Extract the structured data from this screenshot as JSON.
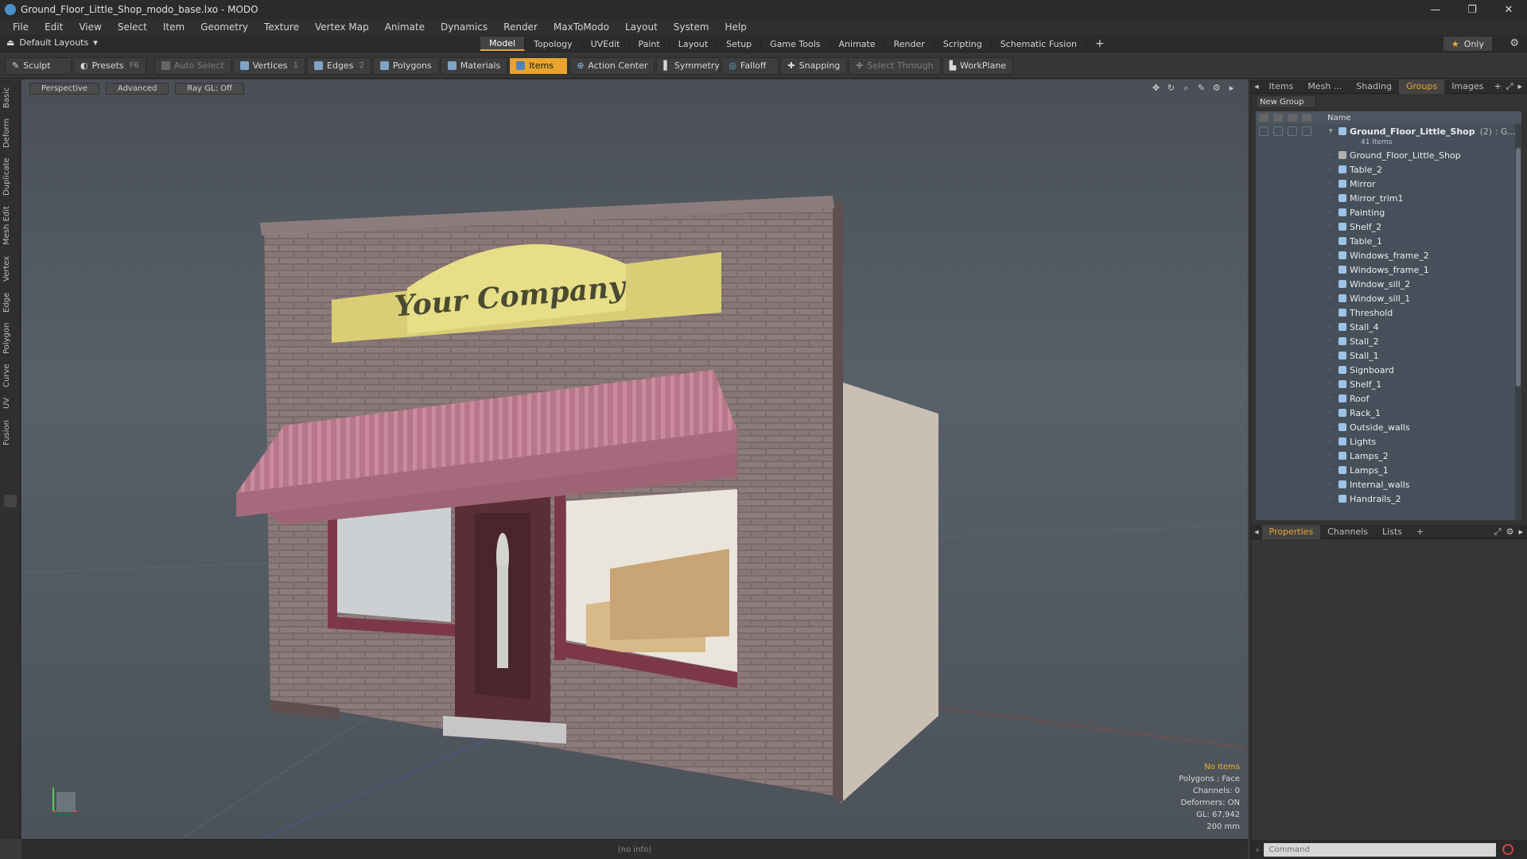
{
  "window": {
    "title": "Ground_Floor_Little_Shop_modo_base.lxo - MODO",
    "controls": [
      "—",
      "❐",
      "✕"
    ]
  },
  "menubar": [
    "File",
    "Edit",
    "View",
    "Select",
    "Item",
    "Geometry",
    "Texture",
    "Vertex Map",
    "Animate",
    "Dynamics",
    "Render",
    "MaxToModo",
    "Layout",
    "System",
    "Help"
  ],
  "layoutbar": {
    "layouts_label": "Default Layouts",
    "tabs": [
      "Model",
      "Topology",
      "UVEdit",
      "Paint",
      "Layout",
      "Setup",
      "Game Tools",
      "Animate",
      "Render",
      "Scripting",
      "Schematic Fusion"
    ],
    "active_tab": "Model",
    "add_label": "+",
    "only_label": "Only"
  },
  "toolbar": {
    "sculpt": "Sculpt",
    "presets": "Presets",
    "presets_key": "F6",
    "auto_select": "Auto Select",
    "vertices": "Vertices",
    "vertices_count": "1",
    "edges": "Edges",
    "edges_count": "2",
    "polygons": "Polygons",
    "materials": "Materials",
    "items": "Items",
    "action_center": "Action Center",
    "symmetry": "Symmetry",
    "falloff": "Falloff",
    "snapping": "Snapping",
    "select_through": "Select Through",
    "workplane": "WorkPlane"
  },
  "left_tabs": [
    "Basic",
    "Deform",
    "Duplicate",
    "Mesh Edit",
    "Vertex",
    "Edge",
    "Polygon",
    "Curve",
    "UV",
    "Fusion"
  ],
  "viewport": {
    "header": [
      "Perspective",
      "Advanced",
      "Ray GL: Off"
    ],
    "sign_text": "Your Company",
    "info": {
      "no_items": "No Items",
      "polygons": "Polygons : Face",
      "channels": "Channels: 0",
      "deformers": "Deformers: ON",
      "gl": "GL: 67,942",
      "scale": "200 mm"
    },
    "status": "(no info)"
  },
  "right_panel": {
    "tabs": [
      "Items",
      "Mesh ...",
      "Shading",
      "Groups",
      "Images"
    ],
    "active_tab": "Groups",
    "new_group": "New Group",
    "name_header": "Name",
    "root_name": "Ground_Floor_Little_Shop",
    "root_count": "(2) : G...",
    "root_sub": "41 Items",
    "items": [
      "Ground_Floor_Little_Shop",
      "Table_2",
      "Mirror",
      "Mirror_trim1",
      "Painting",
      "Shelf_2",
      "Table_1",
      "Windows_frame_2",
      "Windows_frame_1",
      "Window_sill_2",
      "Window_sill_1",
      "Threshold",
      "Stall_4",
      "Stall_2",
      "Stall_1",
      "Signboard",
      "Shelf_1",
      "Roof",
      "Rack_1",
      "Outside_walls",
      "Lights",
      "Lamps_2",
      "Lamps_1",
      "Internal_walls",
      "Handrails_2"
    ],
    "bottom_tabs": [
      "Properties",
      "Channels",
      "Lists"
    ],
    "bottom_active": "Properties",
    "command_placeholder": "Command"
  }
}
